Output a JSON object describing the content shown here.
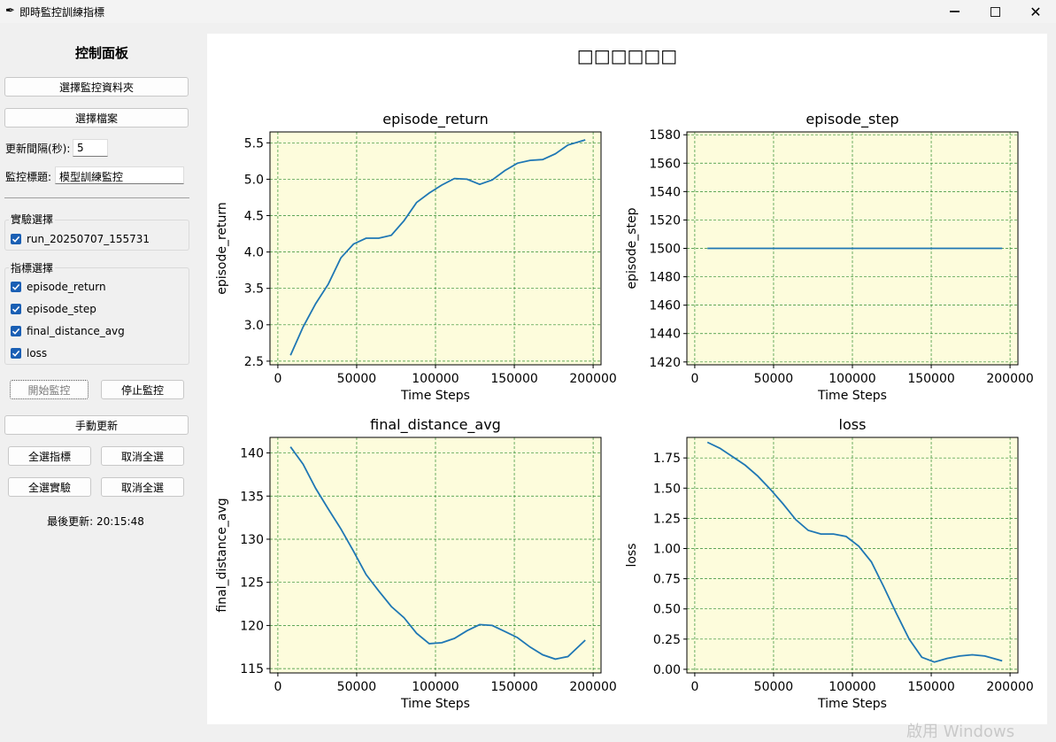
{
  "window": {
    "title": "即時監控訓練指標"
  },
  "panel": {
    "title": "控制面板",
    "select_folder": "選擇監控資料夾",
    "select_file": "選擇檔案",
    "interval_label": "更新間隔(秒):",
    "interval_value": "5",
    "monitor_title_label": "監控標題:",
    "monitor_title_value": "模型訓練監控",
    "exp_group": "實驗選擇",
    "experiments": [
      "run_20250707_155731"
    ],
    "metric_group": "指標選擇",
    "metrics": [
      "episode_return",
      "episode_step",
      "final_distance_avg",
      "loss"
    ],
    "start": "開始監控",
    "stop": "停止監控",
    "manual": "手動更新",
    "select_all_metrics": "全選指標",
    "clear_metrics": "取消全選",
    "select_all_exps": "全選實驗",
    "clear_exps": "取消全選",
    "last_update": "最後更新: 20:15:48"
  },
  "main": {
    "title": "□□□□□□"
  },
  "watermark": "啟用 Windows",
  "chart_data": [
    {
      "type": "line",
      "title": "episode_return",
      "xlabel": "Time Steps",
      "ylabel": "episode_return",
      "xlim": [
        -5000,
        205000
      ],
      "ylim": [
        2.45,
        5.65
      ],
      "xticks": [
        0,
        50000,
        100000,
        150000,
        200000
      ],
      "yticks": [
        2.5,
        3.0,
        3.5,
        4.0,
        4.5,
        5.0,
        5.5
      ],
      "x": [
        8000,
        16000,
        24000,
        32000,
        40000,
        48000,
        56000,
        64000,
        72000,
        80000,
        88000,
        96000,
        104000,
        112000,
        120000,
        128000,
        136000,
        144000,
        152000,
        160000,
        168000,
        176000,
        184000,
        195000
      ],
      "series": [
        {
          "values": [
            2.58,
            2.97,
            3.29,
            3.56,
            3.92,
            4.11,
            4.19,
            4.19,
            4.23,
            4.43,
            4.68,
            4.81,
            4.92,
            5.01,
            5.0,
            4.93,
            4.99,
            5.12,
            5.22,
            5.26,
            5.27,
            5.35,
            5.47,
            5.54
          ]
        }
      ]
    },
    {
      "type": "line",
      "title": "episode_step",
      "xlabel": "Time Steps",
      "ylabel": "episode_step",
      "xlim": [
        -5000,
        205000
      ],
      "ylim": [
        1418,
        1582
      ],
      "xticks": [
        0,
        50000,
        100000,
        150000,
        200000
      ],
      "yticks": [
        1420,
        1440,
        1460,
        1480,
        1500,
        1520,
        1540,
        1560,
        1580
      ],
      "x": [
        8000,
        195000
      ],
      "series": [
        {
          "values": [
            1500,
            1500
          ]
        }
      ]
    },
    {
      "type": "line",
      "title": "final_distance_avg",
      "xlabel": "Time Steps",
      "ylabel": "final_distance_avg",
      "xlim": [
        -5000,
        205000
      ],
      "ylim": [
        114.5,
        141.8
      ],
      "xticks": [
        0,
        50000,
        100000,
        150000,
        200000
      ],
      "yticks": [
        115,
        120,
        125,
        130,
        135,
        140
      ],
      "x": [
        8000,
        16000,
        24000,
        32000,
        40000,
        48000,
        56000,
        64000,
        72000,
        80000,
        88000,
        96000,
        104000,
        112000,
        120000,
        128000,
        136000,
        144000,
        152000,
        160000,
        168000,
        176000,
        184000,
        195000
      ],
      "series": [
        {
          "values": [
            140.7,
            138.7,
            135.9,
            133.5,
            131.2,
            128.6,
            125.9,
            124.0,
            122.2,
            120.9,
            119.1,
            117.9,
            118.0,
            118.5,
            119.4,
            120.1,
            120.0,
            119.3,
            118.6,
            117.5,
            116.6,
            116.1,
            116.4,
            118.3
          ]
        }
      ]
    },
    {
      "type": "line",
      "title": "loss",
      "xlabel": "Time Steps",
      "ylabel": "loss",
      "xlim": [
        -5000,
        205000
      ],
      "ylim": [
        -0.03,
        1.92
      ],
      "xticks": [
        0,
        50000,
        100000,
        150000,
        200000
      ],
      "yticks": [
        0.0,
        0.25,
        0.5,
        0.75,
        1.0,
        1.25,
        1.5,
        1.75
      ],
      "x": [
        8000,
        16000,
        24000,
        32000,
        40000,
        48000,
        56000,
        64000,
        72000,
        80000,
        88000,
        96000,
        104000,
        112000,
        120000,
        128000,
        136000,
        144000,
        152000,
        160000,
        168000,
        176000,
        184000,
        195000
      ],
      "series": [
        {
          "values": [
            1.88,
            1.83,
            1.76,
            1.69,
            1.6,
            1.49,
            1.37,
            1.24,
            1.15,
            1.12,
            1.12,
            1.1,
            1.02,
            0.89,
            0.68,
            0.46,
            0.25,
            0.1,
            0.06,
            0.09,
            0.11,
            0.12,
            0.11,
            0.07
          ]
        }
      ]
    }
  ]
}
